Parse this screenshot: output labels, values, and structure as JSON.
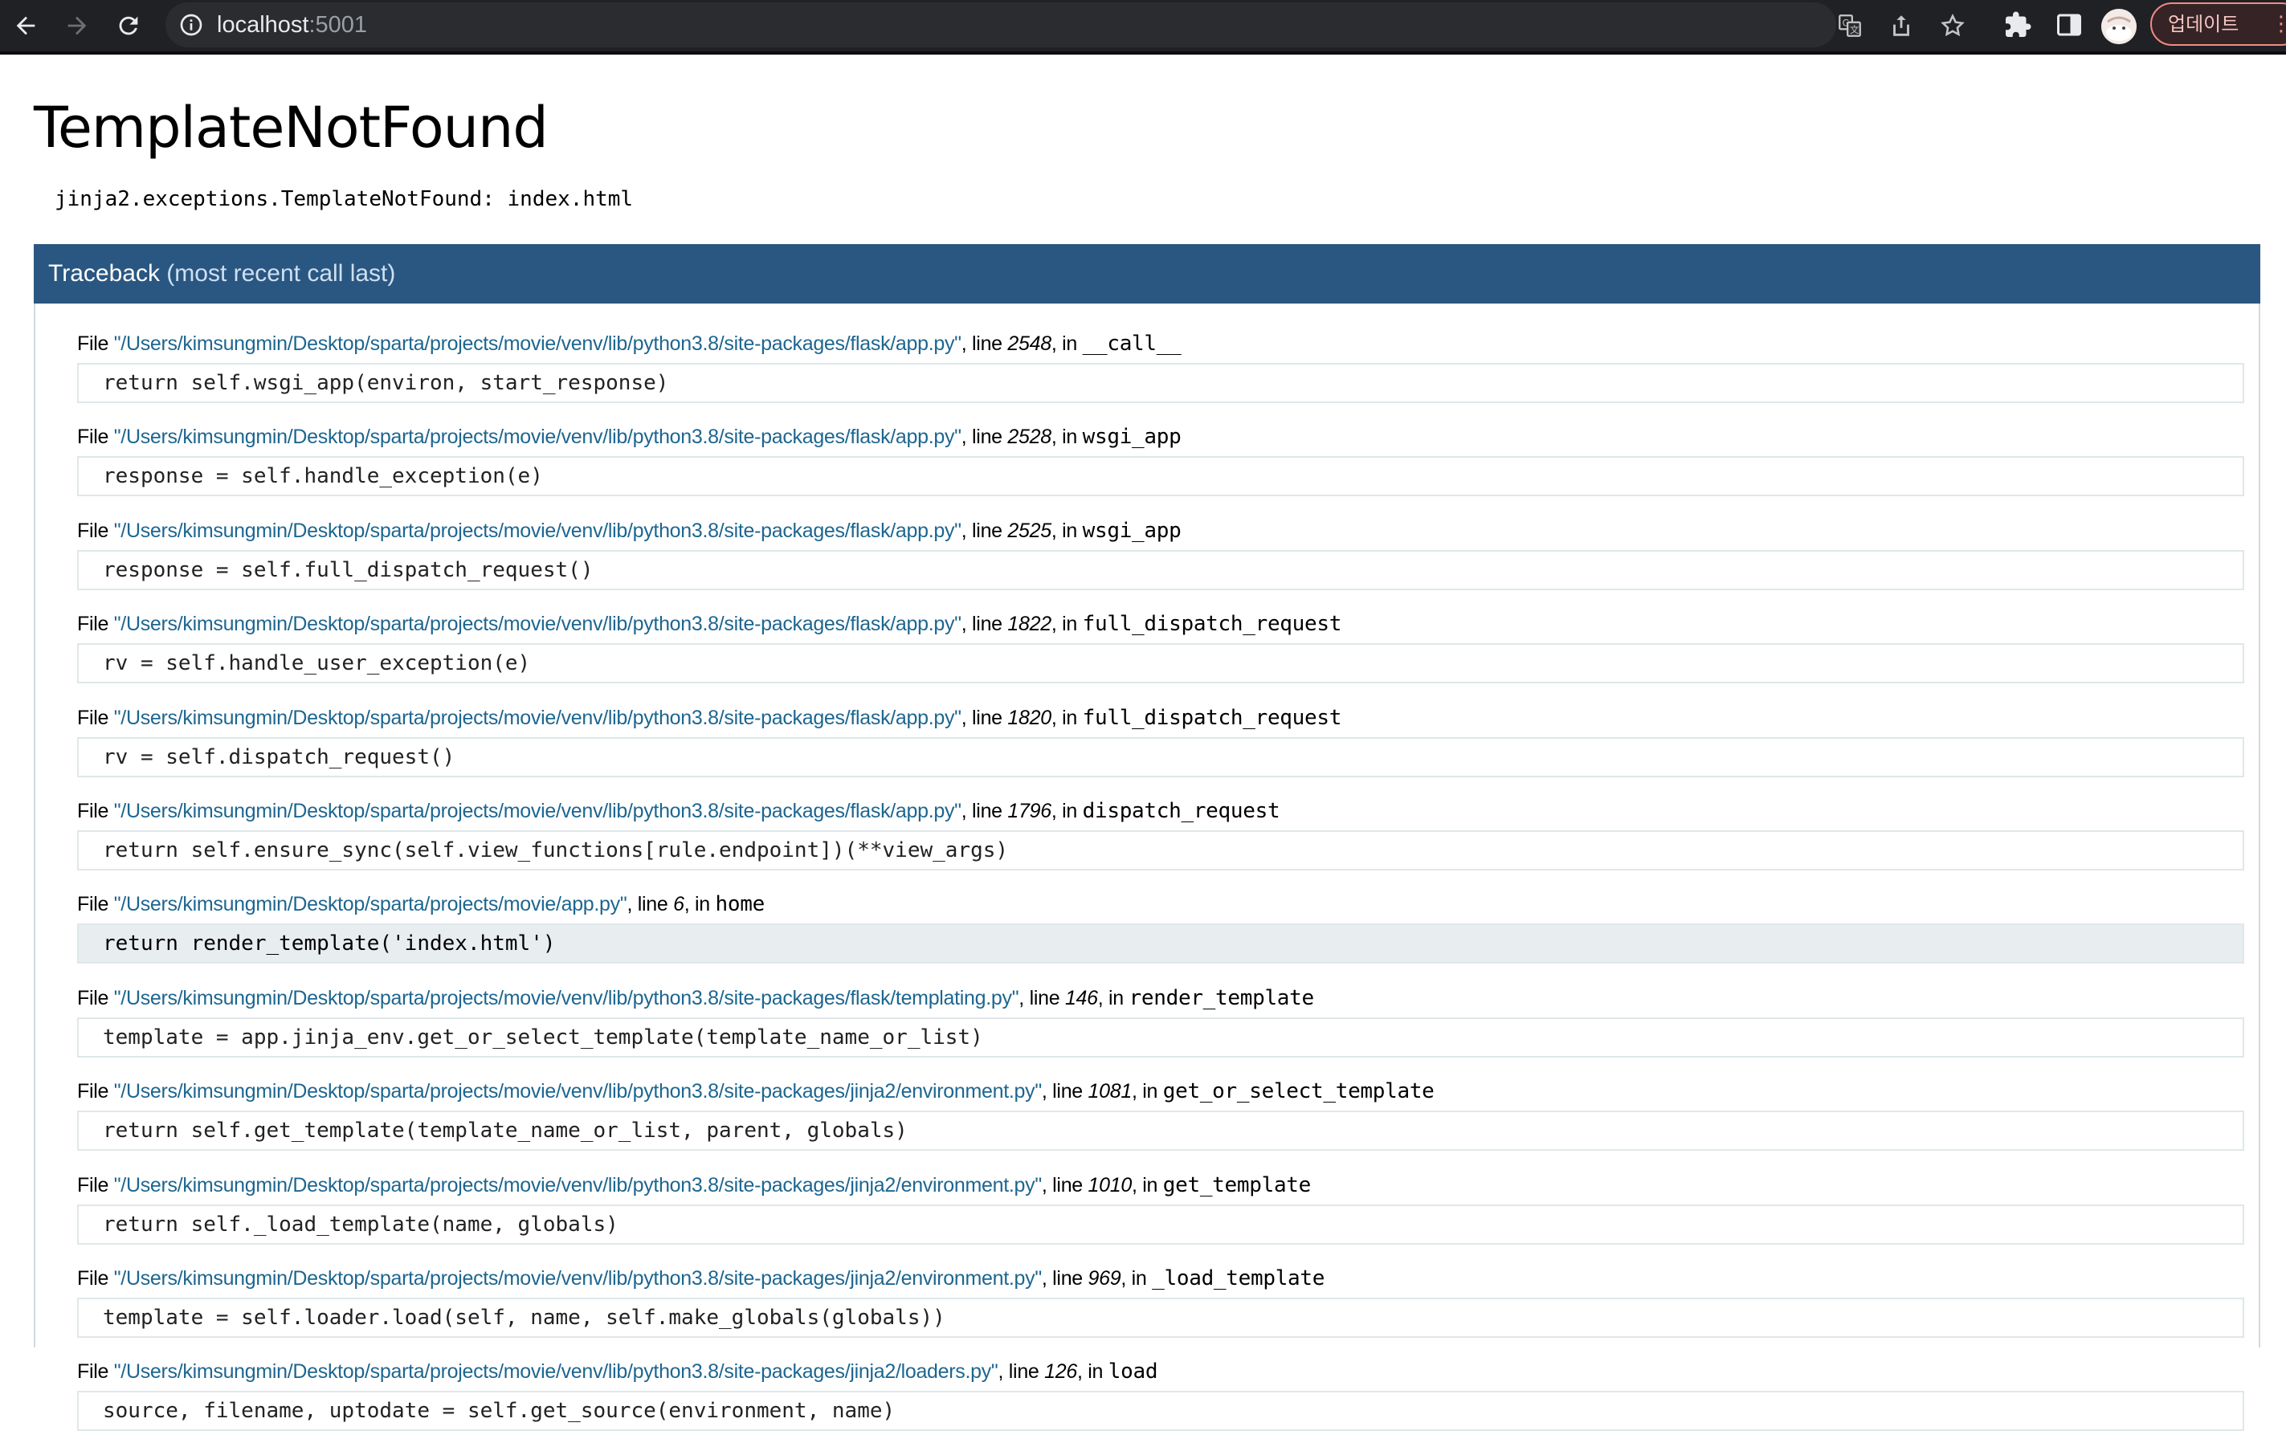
{
  "browser": {
    "url_host": "localhost",
    "url_port": ":5001",
    "update_label": "업데이트",
    "menu_glyph": "⋮",
    "icons": [
      "back-icon",
      "forward-icon",
      "reload-icon",
      "site-info-icon",
      "translate-icon",
      "share-icon",
      "bookmark-star-icon",
      "extensions-icon",
      "side-panel-icon",
      "profile-avatar",
      "more-menu-icon"
    ]
  },
  "page": {
    "title": "TemplateNotFound",
    "error_message": "jinja2.exceptions.TemplateNotFound: index.html",
    "traceback_label": "Traceback",
    "traceback_note": "(most recent call last)"
  },
  "frames": [
    {
      "file": "\"/Users/kimsungmin/Desktop/sparta/projects/movie/venv/lib/python3.8/site-packages/flask/app.py\"",
      "line": "2548",
      "func": "__call__",
      "code": "return self.wsgi_app(environ, start_response)",
      "current": false
    },
    {
      "file": "\"/Users/kimsungmin/Desktop/sparta/projects/movie/venv/lib/python3.8/site-packages/flask/app.py\"",
      "line": "2528",
      "func": "wsgi_app",
      "code": "response = self.handle_exception(e)",
      "current": false
    },
    {
      "file": "\"/Users/kimsungmin/Desktop/sparta/projects/movie/venv/lib/python3.8/site-packages/flask/app.py\"",
      "line": "2525",
      "func": "wsgi_app",
      "code": "response = self.full_dispatch_request()",
      "current": false
    },
    {
      "file": "\"/Users/kimsungmin/Desktop/sparta/projects/movie/venv/lib/python3.8/site-packages/flask/app.py\"",
      "line": "1822",
      "func": "full_dispatch_request",
      "code": "rv = self.handle_user_exception(e)",
      "current": false
    },
    {
      "file": "\"/Users/kimsungmin/Desktop/sparta/projects/movie/venv/lib/python3.8/site-packages/flask/app.py\"",
      "line": "1820",
      "func": "full_dispatch_request",
      "code": "rv = self.dispatch_request()",
      "current": false
    },
    {
      "file": "\"/Users/kimsungmin/Desktop/sparta/projects/movie/venv/lib/python3.8/site-packages/flask/app.py\"",
      "line": "1796",
      "func": "dispatch_request",
      "code": "return self.ensure_sync(self.view_functions[rule.endpoint])(**view_args)",
      "current": false
    },
    {
      "file": "\"/Users/kimsungmin/Desktop/sparta/projects/movie/app.py\"",
      "line": "6",
      "func": "home",
      "code": "return render_template('index.html')",
      "current": true
    },
    {
      "file": "\"/Users/kimsungmin/Desktop/sparta/projects/movie/venv/lib/python3.8/site-packages/flask/templating.py\"",
      "line": "146",
      "func": "render_template",
      "code": "template = app.jinja_env.get_or_select_template(template_name_or_list)",
      "current": false
    },
    {
      "file": "\"/Users/kimsungmin/Desktop/sparta/projects/movie/venv/lib/python3.8/site-packages/jinja2/environment.py\"",
      "line": "1081",
      "func": "get_or_select_template",
      "code": "return self.get_template(template_name_or_list, parent, globals)",
      "current": false
    },
    {
      "file": "\"/Users/kimsungmin/Desktop/sparta/projects/movie/venv/lib/python3.8/site-packages/jinja2/environment.py\"",
      "line": "1010",
      "func": "get_template",
      "code": "return self._load_template(name, globals)",
      "current": false
    },
    {
      "file": "\"/Users/kimsungmin/Desktop/sparta/projects/movie/venv/lib/python3.8/site-packages/jinja2/environment.py\"",
      "line": "969",
      "func": "_load_template",
      "code": "template = self.loader.load(self, name, self.make_globals(globals))",
      "current": false
    },
    {
      "file": "\"/Users/kimsungmin/Desktop/sparta/projects/movie/venv/lib/python3.8/site-packages/jinja2/loaders.py\"",
      "line": "126",
      "func": "load",
      "code": "source, filename, uptodate = self.get_source(environment, name)",
      "current": false
    }
  ]
}
